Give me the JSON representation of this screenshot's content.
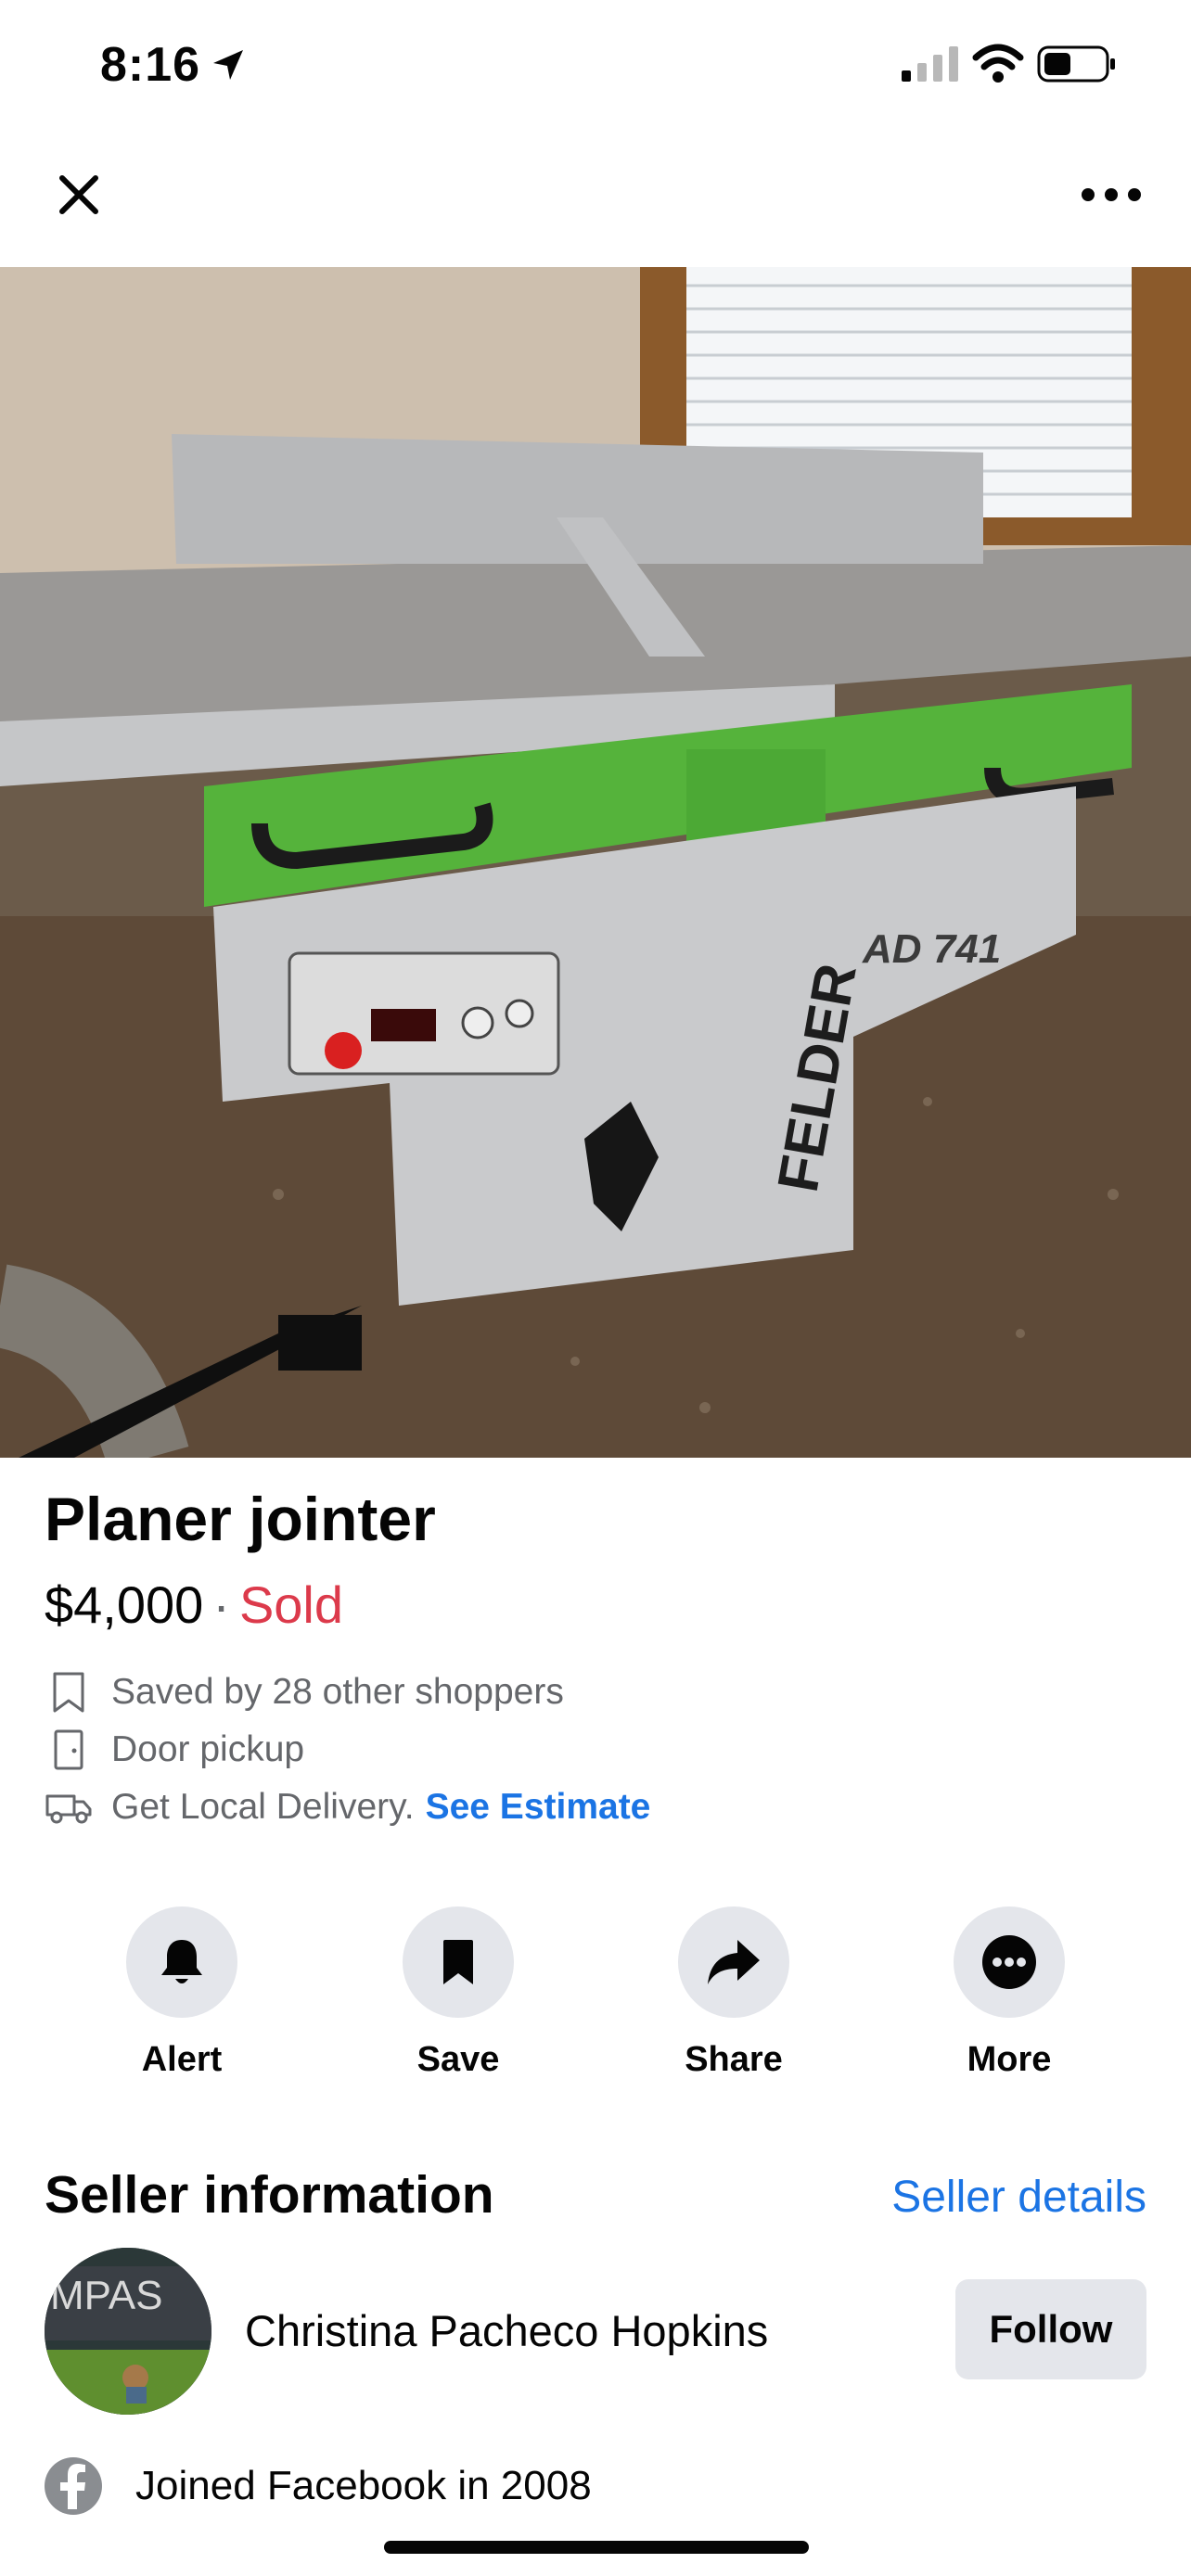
{
  "status_bar": {
    "time": "8:16"
  },
  "nav": {
    "close_icon": "close-icon",
    "more_icon": "more-horizontal-icon"
  },
  "listing": {
    "title": "Planer jointer",
    "price": "$4,000",
    "separator": "·",
    "status": "Sold",
    "meta": [
      {
        "icon": "bookmark-outline-icon",
        "text": "Saved by 28 other shoppers"
      },
      {
        "icon": "door-icon",
        "text": "Door pickup"
      },
      {
        "icon": "truck-icon",
        "text": "Get Local Delivery.",
        "link": "See Estimate"
      }
    ],
    "photo_text": {
      "model": "AD 741",
      "brand": "FELDER"
    }
  },
  "actions": [
    {
      "label": "Alert",
      "icon": "bell-icon"
    },
    {
      "label": "Save",
      "icon": "bookmark-icon"
    },
    {
      "label": "Share",
      "icon": "share-arrow-icon"
    },
    {
      "label": "More",
      "icon": "more-circle-icon"
    }
  ],
  "seller": {
    "heading": "Seller information",
    "details_link": "Seller details",
    "name": "Christina Pacheco Hopkins",
    "follow_label": "Follow",
    "avatar_text": "MPAS",
    "joined": "Joined Facebook in 2008"
  },
  "colors": {
    "sold": "#dc3a4b",
    "link": "#1b74e4",
    "button_bg": "#e4e6eb",
    "secondary_text": "#65676b"
  }
}
